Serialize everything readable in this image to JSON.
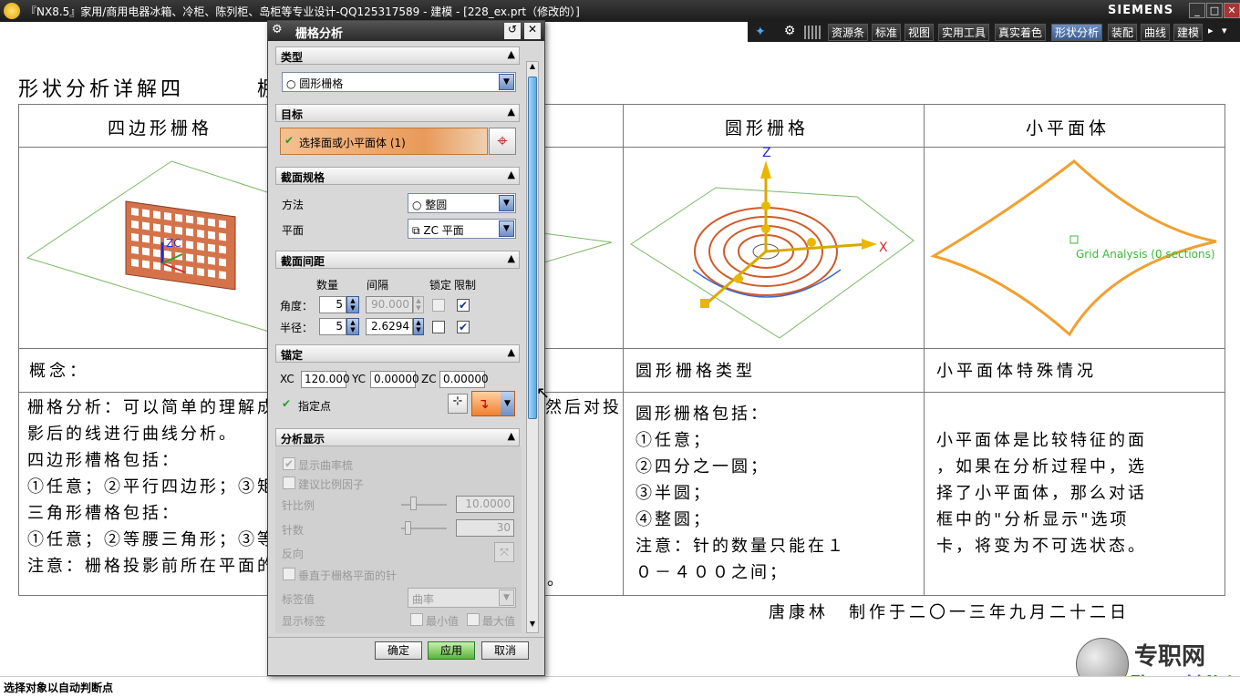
{
  "window": {
    "title": "『NX8.5』家用/商用电器冰箱、冷柜、陈列柜、岛柜等专业设计-QQ125317589 - 建模 - [228_ex.prt（修改的）]",
    "brand": "SIEMENS",
    "min": "_",
    "max": "□",
    "close": "✕"
  },
  "toolbar": {
    "items": [
      "资源条",
      "标准",
      "视图",
      "实用工具",
      "真实着色",
      "形状分析",
      "装配",
      "曲线",
      "建模"
    ],
    "active": "形状分析"
  },
  "page": {
    "heading": "形状分析详解四",
    "heading_tail": "棚",
    "col1_title": "四边形栅格",
    "col3_title": "圆形栅格",
    "col4_title": "小平面体",
    "grid_label": "Grid Analysis (0 sections)",
    "zc_label": "ZC",
    "z_label": "Z",
    "x_label": "X",
    "row2": {
      "concept": "概念：",
      "circular_type": "圆形栅格类型",
      "facet_special": "小平面体特殊情况"
    },
    "col1_lines": [
      "栅格分析：可以简单的理解成",
      "影后的线进行曲线分析。",
      "四边形槽格包括：",
      "①任意；②平行四边形；③矩",
      "三角形槽格包括：",
      "①任意；②等腰三角形；③等",
      "注意：栅格投影前所在平面的"
    ],
    "col2_lines": [
      "然后对投",
      "。"
    ],
    "col3_lines": [
      "圆形栅格包括：",
      "①任意；",
      "②四分之一圆；",
      "③半圆；",
      "④整圆；",
      "注意：针的数量只能在１",
      "０－４００之间；"
    ],
    "col4_lines": [
      "小平面体是比较特征的面",
      "，如果在分析过程中，选",
      "择了小平面体，那么对话",
      "框中的\"分析显示\"选项",
      "卡，将变为不可选状态。"
    ],
    "footer": "唐康林　制作于二〇一三年九月二十二日",
    "watermark": {
      "cn": "专职网",
      "en": "Zhuanzhi.Net"
    }
  },
  "dialog": {
    "title": "栅格分析",
    "sec_type": {
      "label": "类型",
      "value": "圆形栅格"
    },
    "sec_target": {
      "label": "目标",
      "select": "选择面或小平面体 (1)"
    },
    "sec_spec": {
      "label": "截面规格",
      "method_label": "方法",
      "method_value": "整圆",
      "plane_label": "平面",
      "plane_value": "ZC 平面"
    },
    "sec_spacing": {
      "label": "截面间距",
      "col_count": "数量",
      "col_interval": "间隔",
      "col_lock": "锁定",
      "col_limit": "限制",
      "angle_label": "角度：",
      "angle_count": "5",
      "angle_interval": "90.000",
      "radius_label": "半径：",
      "radius_count": "5",
      "radius_interval": "2.6294"
    },
    "sec_anchor": {
      "label": "锚定",
      "xc_label": "XC",
      "xc": "120.000",
      "yc_label": "YC",
      "yc": "0.00000",
      "zc_label": "ZC",
      "zc": "0.00000",
      "point_label": "指定点"
    },
    "sec_display": {
      "label": "分析显示",
      "show_comb": "显示曲率梳",
      "suggest_scale": "建议比例因子",
      "needle_scale_label": "针比例",
      "needle_scale": "10.0000",
      "needle_count_label": "针数",
      "needle_count": "30",
      "reverse_label": "反向",
      "perp_needle": "垂直于栅格平面的针",
      "tag_label": "标签值",
      "tag_value": "曲率",
      "show_tag_label": "显示标签",
      "min": "最小值",
      "max": "最大值"
    },
    "buttons": {
      "ok": "确定",
      "apply": "应用",
      "cancel": "取消"
    }
  },
  "status": "选择对象以自动判断点"
}
